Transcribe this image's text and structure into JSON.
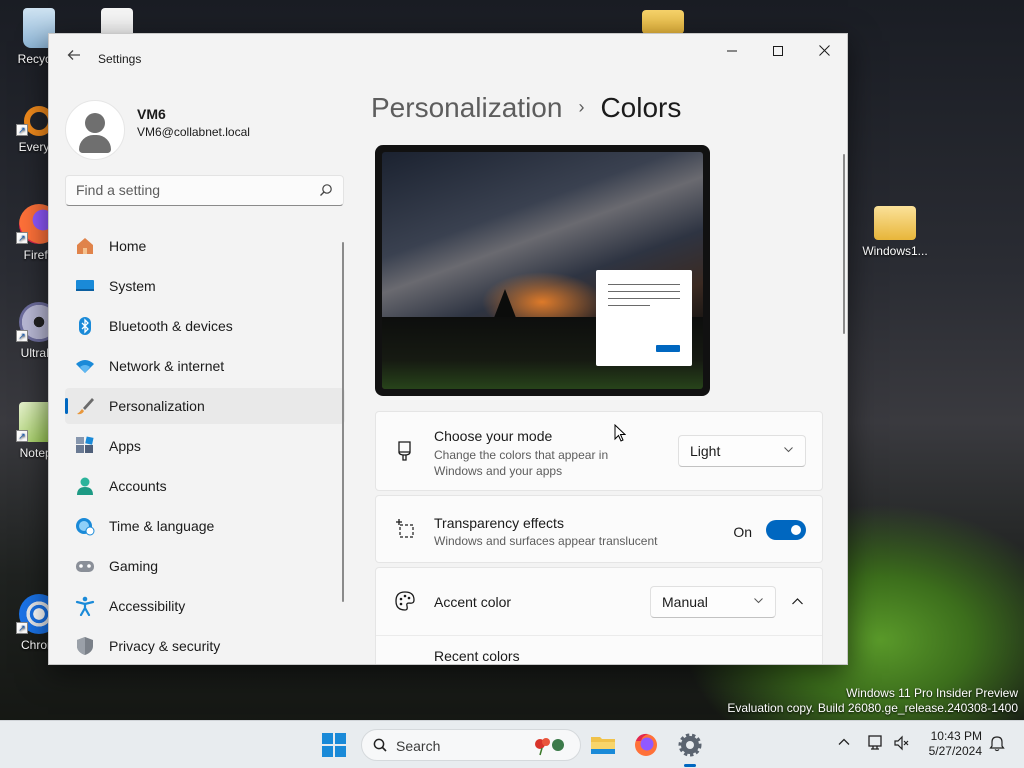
{
  "desktop": {
    "icons": [
      {
        "label": "Recycle",
        "icon": "recycle-bin-icon"
      },
      {
        "label": "Everyth",
        "icon": "everything-search-icon"
      },
      {
        "label": "Firefo",
        "icon": "firefox-icon"
      },
      {
        "label": "UltraIS",
        "icon": "ultraiso-icon"
      },
      {
        "label": "Notepa",
        "icon": "notepad-plus-plus-icon"
      },
      {
        "label": "Chrom",
        "icon": "chrome-icon"
      },
      {
        "label": "Windows1...",
        "icon": "folder-icon"
      }
    ],
    "watermark": {
      "line1": "Windows 11 Pro Insider Preview",
      "line2": "Evaluation copy. Build 26080.ge_release.240308-1400"
    }
  },
  "window": {
    "app_title": "Settings",
    "controls": {
      "minimize": "—",
      "maximize": "☐",
      "close": "✕"
    }
  },
  "user": {
    "name": "VM6",
    "email": "VM6@collabnet.local"
  },
  "search": {
    "placeholder": "Find a setting"
  },
  "nav": [
    {
      "label": "Home",
      "icon": "home-icon"
    },
    {
      "label": "System",
      "icon": "system-display-icon"
    },
    {
      "label": "Bluetooth & devices",
      "icon": "bluetooth-icon"
    },
    {
      "label": "Network & internet",
      "icon": "wifi-icon"
    },
    {
      "label": "Personalization",
      "icon": "paintbrush-icon",
      "active": true
    },
    {
      "label": "Apps",
      "icon": "apps-icon"
    },
    {
      "label": "Accounts",
      "icon": "accounts-icon"
    },
    {
      "label": "Time & language",
      "icon": "globe-clock-icon"
    },
    {
      "label": "Gaming",
      "icon": "gamepad-icon"
    },
    {
      "label": "Accessibility",
      "icon": "accessibility-icon"
    },
    {
      "label": "Privacy & security",
      "icon": "shield-icon"
    }
  ],
  "page": {
    "parent": "Personalization",
    "separator": "›",
    "current": "Colors"
  },
  "settings": {
    "mode": {
      "title": "Choose your mode",
      "desc_line1": "Change the colors that appear in",
      "desc_line2": "Windows and your apps",
      "value": "Light"
    },
    "transparency": {
      "title": "Transparency effects",
      "desc": "Windows and surfaces appear translucent",
      "state_label": "On"
    },
    "accent": {
      "title": "Accent color",
      "value": "Manual",
      "expand_glyph": "⌃",
      "sub_title": "Recent colors"
    }
  },
  "taskbar": {
    "search_text": "Search",
    "time": "10:43 PM",
    "date": "5/27/2024",
    "accent": "#0067c0"
  }
}
